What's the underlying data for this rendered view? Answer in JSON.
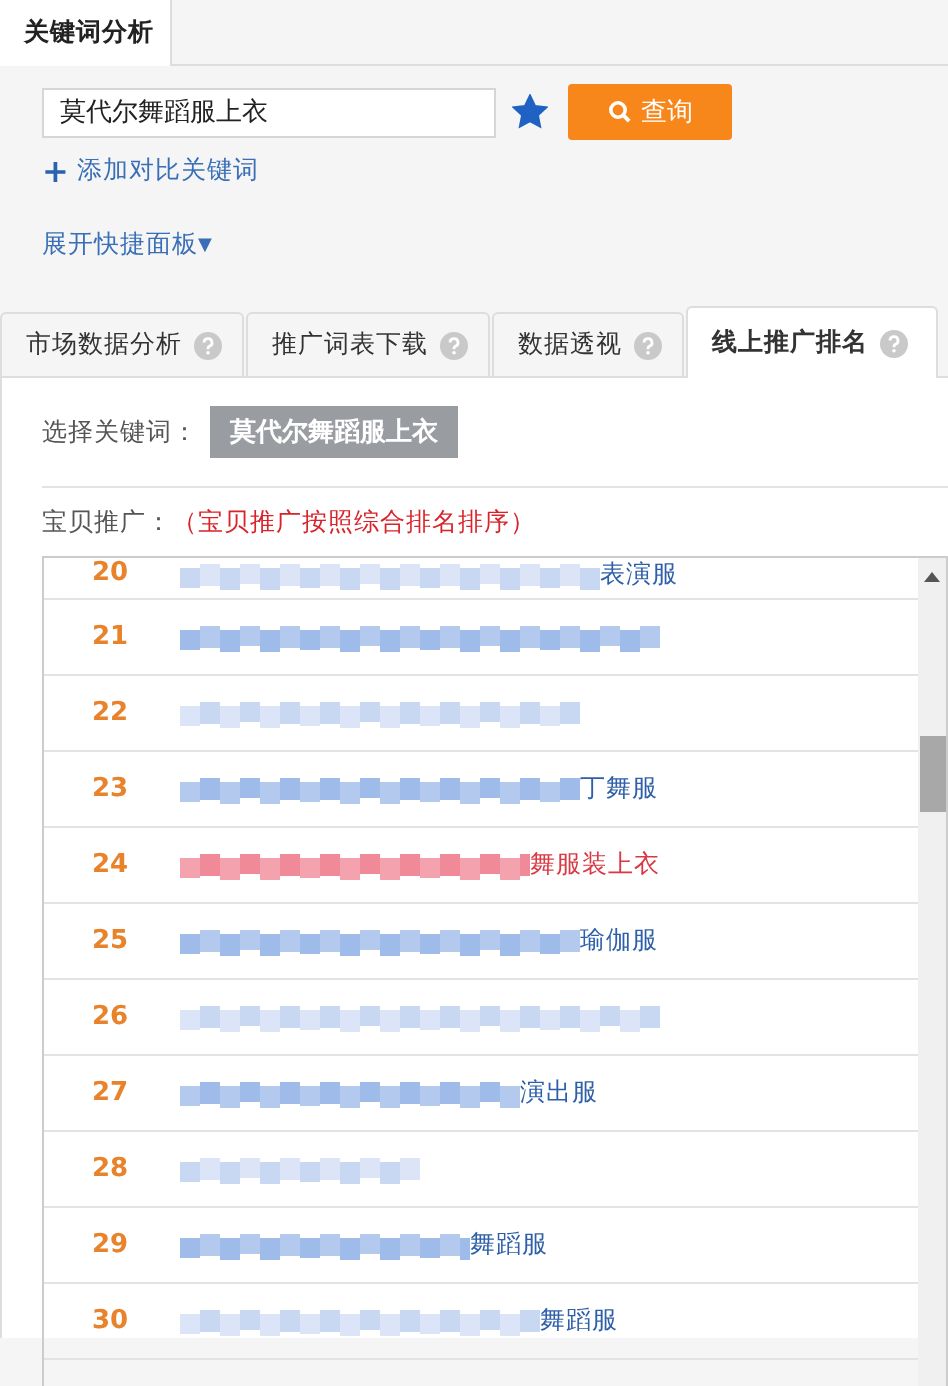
{
  "top_tab": {
    "label": "关键词分析",
    "selected": true
  },
  "search": {
    "value": "莫代尔舞蹈服上衣",
    "starred": true,
    "button": "查询"
  },
  "add_compare": {
    "icon": "+",
    "label": "添加对比关键词"
  },
  "expand_panel": {
    "label": "展开快捷面板",
    "icon": "▼"
  },
  "tabs": [
    {
      "label": "市场数据分析",
      "selected": false
    },
    {
      "label": "推广词表下载",
      "selected": false
    },
    {
      "label": "数据透视",
      "selected": false
    },
    {
      "label": "线上推广排名",
      "selected": true
    }
  ],
  "keyword_select": {
    "label": "选择关键词：",
    "keyword": "莫代尔舞蹈服上衣"
  },
  "promo": {
    "label": "宝贝推广：",
    "note": "（宝贝推广按照综合排名排序）"
  },
  "rows": [
    {
      "rank": "20",
      "title_end": "表演服",
      "highlighted": false
    },
    {
      "rank": "21",
      "highlighted": false
    },
    {
      "rank": "22",
      "highlighted": false
    },
    {
      "rank": "23",
      "title_end": "丁舞服",
      "highlighted": false
    },
    {
      "rank": "24",
      "title_end": "舞服装上衣",
      "highlighted": true
    },
    {
      "rank": "25",
      "title_end": "瑜伽服",
      "highlighted": false
    },
    {
      "rank": "26",
      "highlighted": false
    },
    {
      "rank": "27",
      "title_end": "演出服",
      "highlighted": false
    },
    {
      "rank": "28",
      "highlighted": false
    },
    {
      "rank": "29",
      "title_end": "舞蹈服",
      "highlighted": false
    },
    {
      "rank": "30",
      "title_end": "舞蹈服",
      "highlighted": false
    }
  ]
}
